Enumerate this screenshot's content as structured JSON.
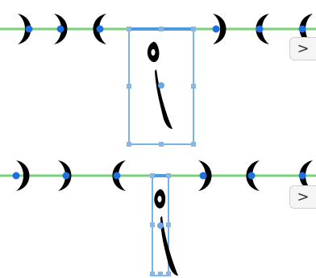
{
  "colors": {
    "baseline": "#7bd07b",
    "selection": "#4a9be0",
    "handle": "#4a9be0",
    "glyph": "#000000",
    "node": "#1e6fe0"
  },
  "rows": [
    {
      "name": "row-1",
      "next_label": ">",
      "left_glyphs": [
        "closing-crescent",
        "closing-crescent",
        "opening-crescent"
      ],
      "right_glyphs": [
        "closing-crescent",
        "opening-crescent",
        "opening-crescent"
      ],
      "selected_glyph": "alef-hamza-below-wide"
    },
    {
      "name": "row-2",
      "next_label": ">",
      "left_glyphs": [
        "closing-crescent",
        "closing-crescent",
        "opening-crescent"
      ],
      "right_glyphs": [
        "closing-crescent",
        "opening-crescent",
        "opening-crescent"
      ],
      "selected_glyph": "alef-hamza-below-narrow"
    }
  ]
}
